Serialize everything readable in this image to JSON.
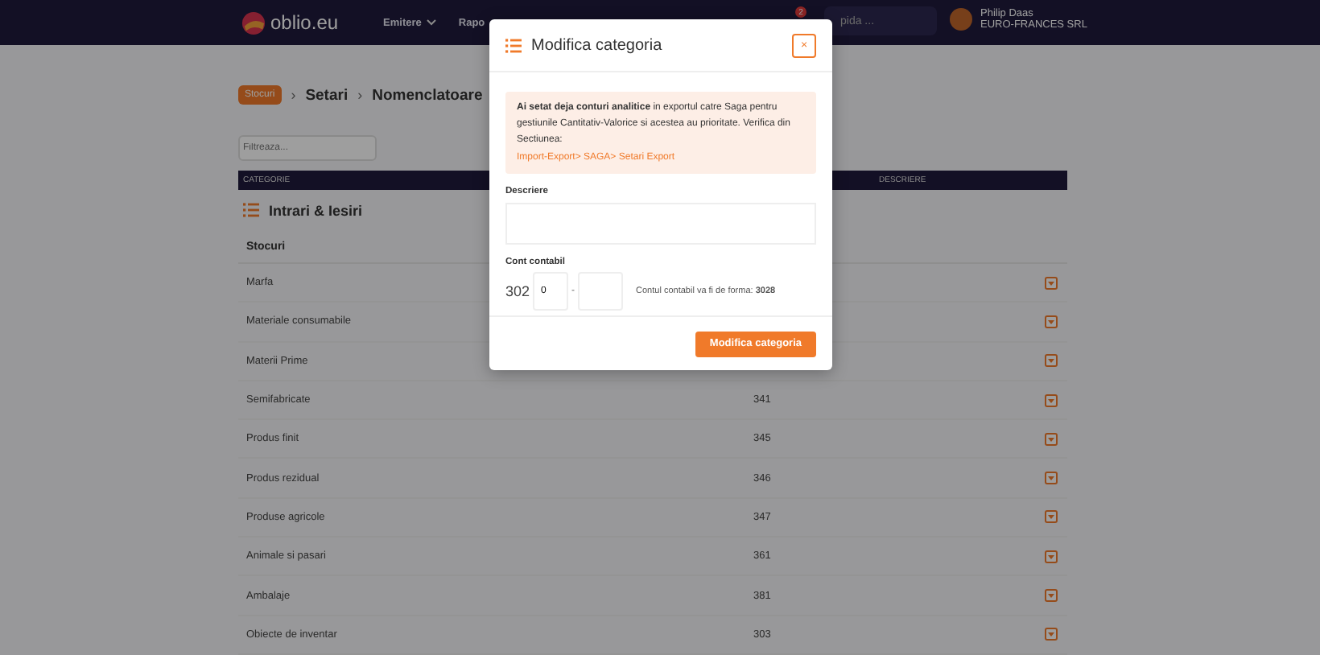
{
  "nav": {
    "logo": "oblio.eu",
    "items": [
      "Emitere",
      "Rapo"
    ],
    "badge": "2",
    "search": {
      "placeholder": "pida ..."
    },
    "user": {
      "name": "Philip Daas",
      "company": "EURO-FRANCES SRL"
    }
  },
  "breadcrumb": {
    "badge": "Stocuri",
    "separators": [
      "›",
      "›"
    ],
    "items": [
      "Setari",
      "Nomenclatoare"
    ]
  },
  "filter": {
    "placeholder": "Filtreaza..."
  },
  "table": {
    "columns": [
      "CATEGORIE",
      "DESCRIERE"
    ],
    "section": "Intrari & Iesiri",
    "group": "Stocuri",
    "rows": [
      {
        "name": "Marfa"
      },
      {
        "name": "Materiale consumabile"
      },
      {
        "name": "Materii Prime"
      },
      {
        "name": "Semifabricate",
        "account": "341"
      },
      {
        "name": "Produs finit",
        "account": "345"
      },
      {
        "name": "Produs rezidual",
        "account": "346"
      },
      {
        "name": "Produse agricole",
        "account": "347"
      },
      {
        "name": "Animale si pasari",
        "account": "361"
      },
      {
        "name": "Ambalaje",
        "account": "381"
      },
      {
        "name": "Obiecte de inventar",
        "account": "303"
      }
    ]
  },
  "modal": {
    "title": "Modifica categoria",
    "close": "×",
    "alert": {
      "text": "**Ai setat deja conturi analitice** in exportul catre Saga pentru gestiunile Cantitativ-Valorice si acestea au prioritate. Verifica din Sectiunea:",
      "link": "Import-Export> SAGA> Setari Export"
    },
    "description": {
      "label": "Descriere"
    },
    "account": {
      "label": "Cont contabil",
      "prefix": "302",
      "value": "0",
      "dash": "-",
      "hint": "Contul contabil va fi de forma: **3028**"
    },
    "submit": "Modifica categoria"
  }
}
